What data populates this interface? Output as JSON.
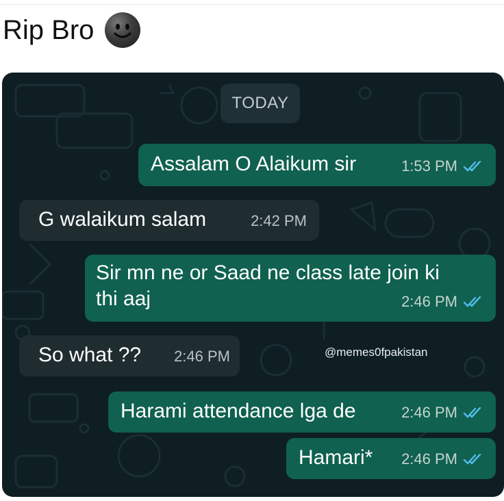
{
  "caption": {
    "text": "Rip Bro",
    "emoji": "smiling-face-emoji"
  },
  "chat": {
    "date_label": "TODAY",
    "watermark": "@memes0fpakistan",
    "colors": {
      "background": "#0e1e22",
      "outgoing": "#10614f",
      "incoming": "#1f2d31",
      "read_ticks": "#53bdeb"
    },
    "messages": [
      {
        "direction": "outgoing",
        "lines": [
          "Assalam O Alaikum sir"
        ],
        "time": "1:53 PM",
        "status": "read"
      },
      {
        "direction": "incoming",
        "lines": [
          "G walaikum salam"
        ],
        "time": "2:42 PM"
      },
      {
        "direction": "outgoing",
        "lines": [
          "Sir mn ne or Saad ne class late join ki",
          "thi aaj"
        ],
        "time": "2:46 PM",
        "status": "read"
      },
      {
        "direction": "incoming",
        "lines": [
          "So what ??"
        ],
        "time": "2:46 PM"
      },
      {
        "direction": "outgoing",
        "lines": [
          "Harami attendance lga de"
        ],
        "time": "2:46 PM",
        "status": "read"
      },
      {
        "direction": "outgoing",
        "lines": [
          "Hamari*"
        ],
        "time": "2:46 PM",
        "status": "read"
      }
    ]
  }
}
